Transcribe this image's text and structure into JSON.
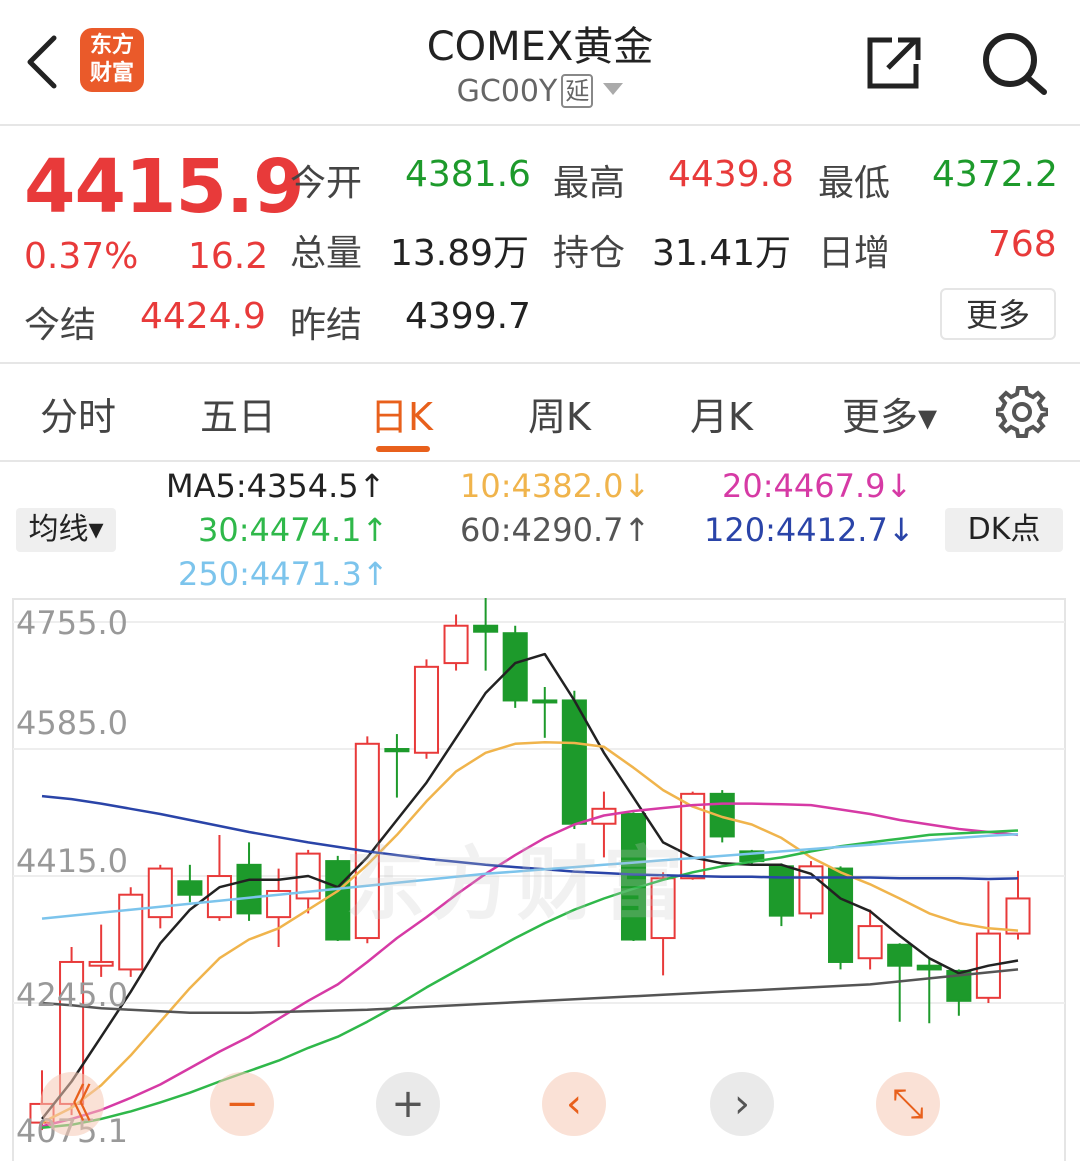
{
  "header": {
    "logo_line1": "东方",
    "logo_line2": "财富",
    "title": "COMEX黄金",
    "code": "GC00Y",
    "delay_tag": "延"
  },
  "quote": {
    "price": "4415.9",
    "change_pct": "0.37%",
    "change": "16.2",
    "open_label": "今开",
    "open": "4381.6",
    "high_label": "最高",
    "high": "4439.8",
    "low_label": "最低",
    "low": "4372.2",
    "volume_label": "总量",
    "volume": "13.89万",
    "oi_label": "持仓",
    "oi": "31.41万",
    "daily_inc_label": "日增",
    "daily_inc": "768",
    "settle_label": "今结",
    "settle": "4424.9",
    "prev_settle_label": "昨结",
    "prev_settle": "4399.7",
    "more_label": "更多"
  },
  "tabs": [
    {
      "label": "分时"
    },
    {
      "label": "五日"
    },
    {
      "label": "日K"
    },
    {
      "label": "周K"
    },
    {
      "label": "月K"
    },
    {
      "label": "更多▾"
    }
  ],
  "ma": {
    "button": "均线▾",
    "dk_button": "DK点",
    "ma5": "MA5:4354.5↑",
    "ma10": "10:4382.0↓",
    "ma20": "20:4467.9↓",
    "ma30": "30:4474.1↑",
    "ma60": "60:4290.7↑",
    "ma120": "120:4412.7↓",
    "ma250": "250:4471.3↑"
  },
  "colors": {
    "up": "#e83a3a",
    "down": "#1d9a2b",
    "ma5": "#222222",
    "ma10": "#f0b44c",
    "ma20": "#d63aa5",
    "ma30": "#2fb84a",
    "ma60": "#555555",
    "ma120": "#2a44a8",
    "ma250": "#7cc4ec"
  },
  "chart_data": {
    "type": "candlestick",
    "y_ticks": [
      "4755.0",
      "4585.0",
      "4415.0",
      "4245.0",
      "4075.1"
    ],
    "ylim": [
      4075.1,
      4755.0
    ],
    "candles": [
      {
        "o": 4085,
        "c": 4110,
        "h": 4155,
        "l": 4075
      },
      {
        "o": 4110,
        "c": 4300,
        "h": 4320,
        "l": 4095
      },
      {
        "o": 4295,
        "c": 4300,
        "h": 4350,
        "l": 4280
      },
      {
        "o": 4290,
        "c": 4390,
        "h": 4400,
        "l": 4280
      },
      {
        "o": 4360,
        "c": 4425,
        "h": 4430,
        "l": 4345
      },
      {
        "o": 4408,
        "c": 4390,
        "h": 4430,
        "l": 4380
      },
      {
        "o": 4360,
        "c": 4415,
        "h": 4470,
        "l": 4355
      },
      {
        "o": 4430,
        "c": 4365,
        "h": 4460,
        "l": 4355
      },
      {
        "o": 4360,
        "c": 4395,
        "h": 4425,
        "l": 4320
      },
      {
        "o": 4385,
        "c": 4445,
        "h": 4450,
        "l": 4365
      },
      {
        "o": 4435,
        "c": 4330,
        "h": 4442,
        "l": 4328
      },
      {
        "o": 4332,
        "c": 4592,
        "h": 4602,
        "l": 4325
      },
      {
        "o": 4585,
        "c": 4582,
        "h": 4605,
        "l": 4520
      },
      {
        "o": 4580,
        "c": 4695,
        "h": 4705,
        "l": 4572
      },
      {
        "o": 4700,
        "c": 4750,
        "h": 4765,
        "l": 4690
      },
      {
        "o": 4750,
        "c": 4742,
        "h": 4790,
        "l": 4690
      },
      {
        "o": 4740,
        "c": 4650,
        "h": 4750,
        "l": 4640
      },
      {
        "o": 4650,
        "c": 4648,
        "h": 4668,
        "l": 4600
      },
      {
        "o": 4650,
        "c": 4485,
        "h": 4663,
        "l": 4478
      },
      {
        "o": 4485,
        "c": 4505,
        "h": 4528,
        "l": 4440
      },
      {
        "o": 4498,
        "c": 4330,
        "h": 4500,
        "l": 4328
      },
      {
        "o": 4332,
        "c": 4412,
        "h": 4420,
        "l": 4282
      },
      {
        "o": 4412,
        "c": 4525,
        "h": 4528,
        "l": 4410
      },
      {
        "o": 4525,
        "c": 4468,
        "h": 4530,
        "l": 4460
      },
      {
        "o": 4448,
        "c": 4435,
        "h": 4450,
        "l": 4430
      },
      {
        "o": 4428,
        "c": 4362,
        "h": 4432,
        "l": 4348
      },
      {
        "o": 4365,
        "c": 4428,
        "h": 4435,
        "l": 4358
      },
      {
        "o": 4425,
        "c": 4300,
        "h": 4428,
        "l": 4290
      },
      {
        "o": 4305,
        "c": 4348,
        "h": 4370,
        "l": 4290
      },
      {
        "o": 4323,
        "c": 4295,
        "h": 4325,
        "l": 4220
      },
      {
        "o": 4295,
        "c": 4290,
        "h": 4305,
        "l": 4218
      },
      {
        "o": 4288,
        "c": 4248,
        "h": 4290,
        "l": 4228
      },
      {
        "o": 4252,
        "c": 4338,
        "h": 4408,
        "l": 4245
      },
      {
        "o": 4338,
        "c": 4385,
        "h": 4422,
        "l": 4330
      }
    ],
    "series": [
      {
        "name": "MA5",
        "values": [
          4090,
          4140,
          4200,
          4260,
          4325,
          4370,
          4400,
          4410,
          4410,
          4415,
          4400,
          4440,
          4490,
          4540,
          4600,
          4660,
          4700,
          4712,
          4650,
          4580,
          4520,
          4460,
          4440,
          4432,
          4430,
          4430,
          4418,
          4385,
          4368,
          4335,
          4305,
          4285,
          4295,
          4302
        ]
      },
      {
        "name": "MA10",
        "values": [
          4085,
          4105,
          4135,
          4175,
          4220,
          4265,
          4305,
          4330,
          4345,
          4370,
          4395,
          4430,
          4470,
          4515,
          4555,
          4580,
          4592,
          4594,
          4593,
          4588,
          4560,
          4530,
          4508,
          4494,
          4484,
          4466,
          4440,
          4420,
          4404,
          4385,
          4365,
          4352,
          4345,
          4342
        ]
      },
      {
        "name": "MA20",
        "values": [
          4080,
          4090,
          4102,
          4118,
          4136,
          4158,
          4180,
          4200,
          4224,
          4248,
          4270,
          4300,
          4332,
          4360,
          4390,
          4418,
          4443,
          4466,
          4484,
          4496,
          4502,
          4506,
          4510,
          4512,
          4512,
          4511,
          4510,
          4504,
          4498,
          4490,
          4484,
          4478,
          4474,
          4470
        ]
      },
      {
        "name": "MA30",
        "values": [
          4078,
          4082,
          4090,
          4100,
          4112,
          4125,
          4140,
          4154,
          4168,
          4185,
          4200,
          4220,
          4242,
          4266,
          4288,
          4310,
          4332,
          4352,
          4370,
          4385,
          4398,
          4410,
          4420,
          4428,
          4434,
          4440,
          4448,
          4455,
          4460,
          4465,
          4470,
          4472,
          4474,
          4476
        ]
      },
      {
        "name": "MA60",
        "values": [
          4245,
          4242,
          4238,
          4236,
          4234,
          4232,
          4232,
          4232,
          4233,
          4234,
          4235,
          4236,
          4238,
          4240,
          4242,
          4244,
          4246,
          4248,
          4250,
          4252,
          4254,
          4256,
          4258,
          4260,
          4262,
          4264,
          4266,
          4268,
          4270,
          4274,
          4278,
          4282,
          4286,
          4290
        ]
      },
      {
        "name": "MA120",
        "values": [
          4522,
          4518,
          4512,
          4505,
          4498,
          4490,
          4482,
          4474,
          4467,
          4460,
          4454,
          4448,
          4443,
          4438,
          4434,
          4430,
          4427,
          4424,
          4421,
          4419,
          4417,
          4416,
          4415,
          4414,
          4414,
          4413,
          4413,
          4413,
          4413,
          4412,
          4412,
          4412,
          4411,
          4412
        ]
      },
      {
        "name": "MA250",
        "values": [
          4358,
          4362,
          4366,
          4370,
          4374,
          4378,
          4382,
          4386,
          4390,
          4394,
          4398,
          4402,
          4406,
          4410,
          4414,
          4418,
          4421,
          4424,
          4427,
          4430,
          4433,
          4436,
          4439,
          4442,
          4445,
          4448,
          4451,
          4454,
          4457,
          4460,
          4463,
          4466,
          4469,
          4471
        ]
      }
    ]
  },
  "watermark": "东方财富",
  "controls": [
    {
      "name": "scroll-left-icon",
      "glyph": "《"
    },
    {
      "name": "zoom-out-icon",
      "glyph": "−"
    },
    {
      "name": "zoom-in-icon",
      "glyph": "+"
    },
    {
      "name": "prev-icon",
      "glyph": "‹"
    },
    {
      "name": "next-icon",
      "glyph": "›"
    },
    {
      "name": "fullscreen-icon",
      "glyph": "⤡"
    }
  ]
}
